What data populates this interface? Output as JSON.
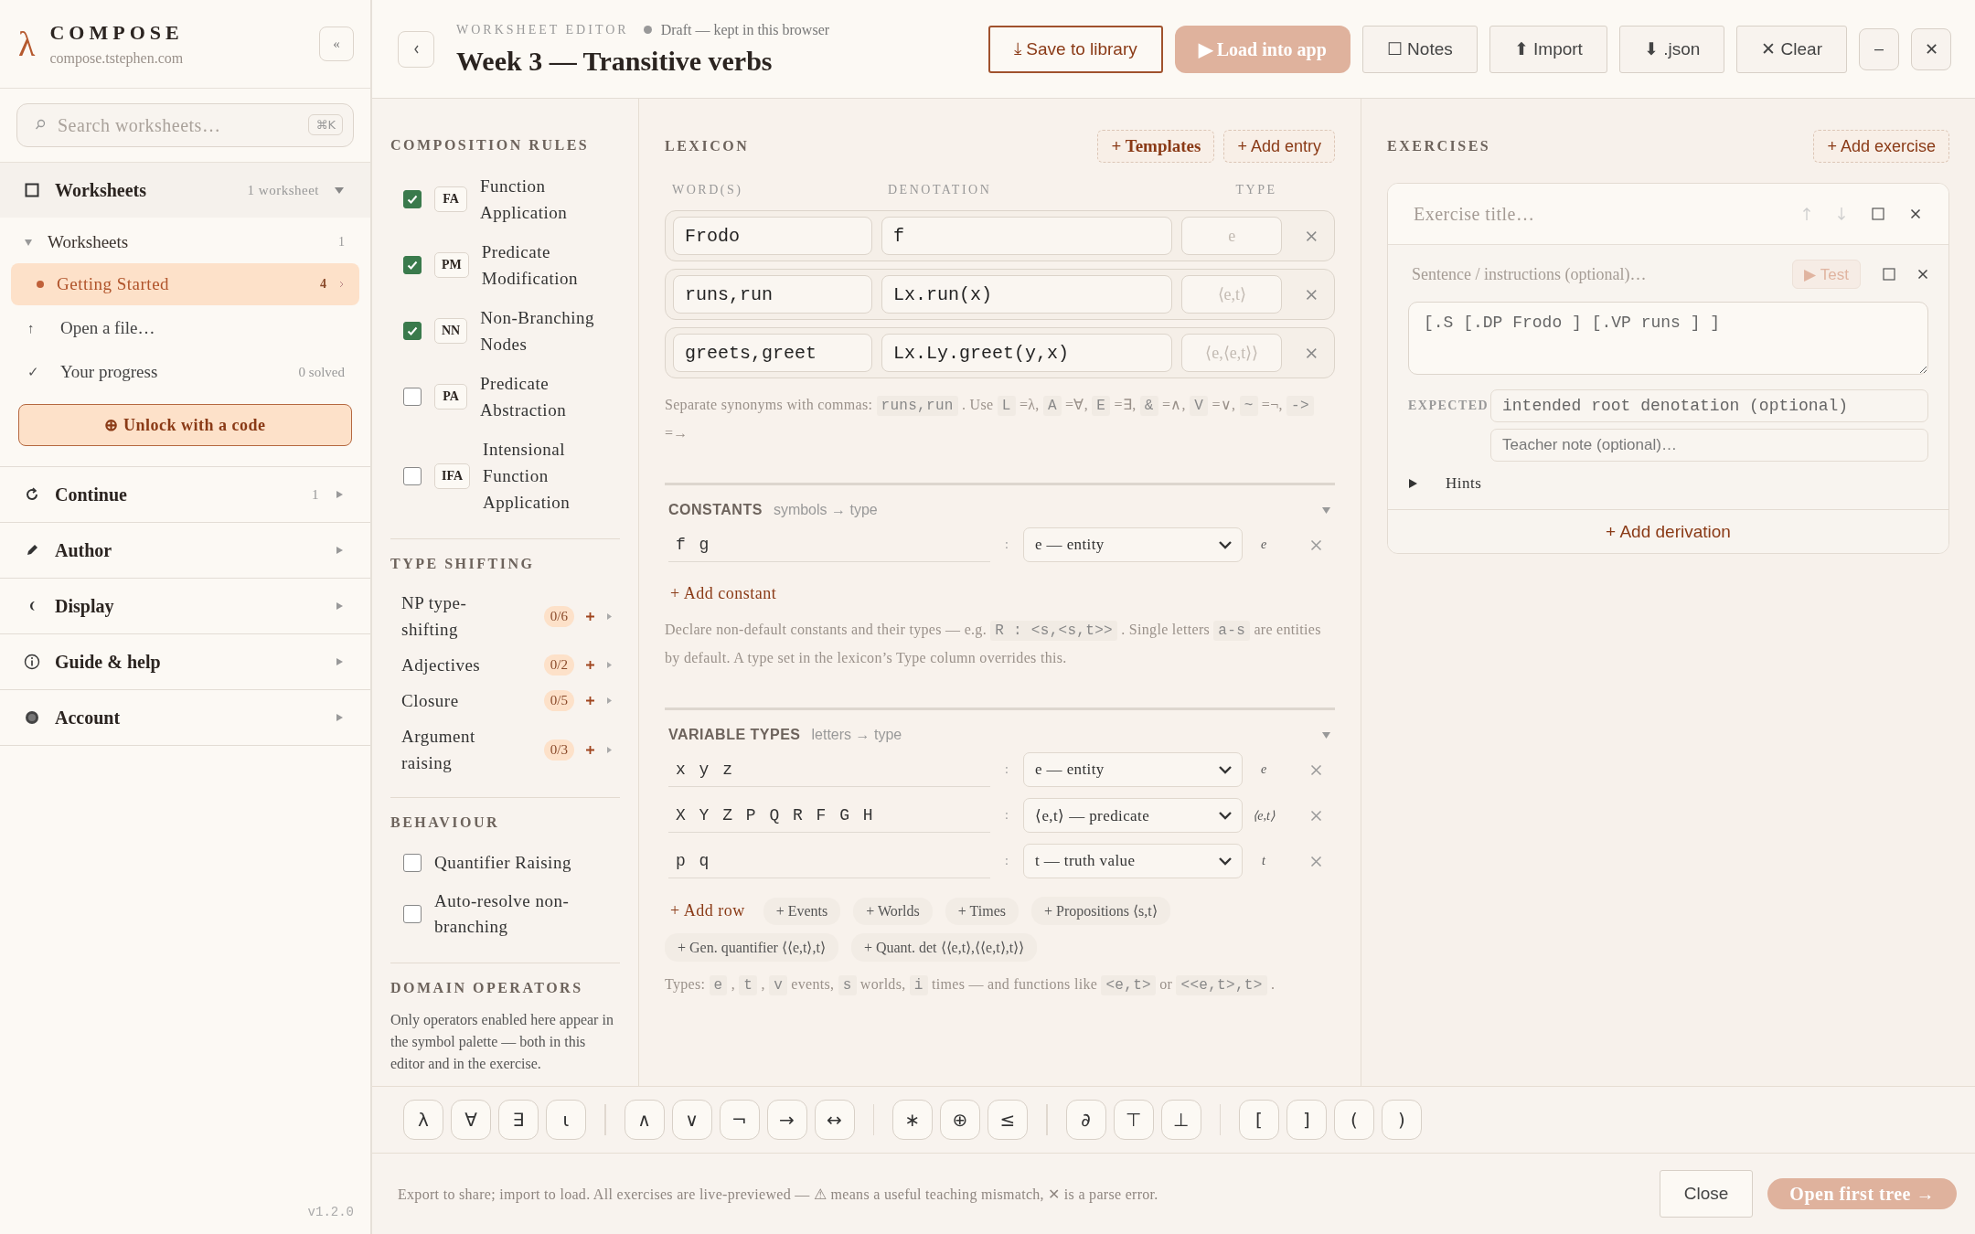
{
  "sidebar": {
    "brand": {
      "logo": "λ",
      "name": "COMPOSE",
      "url": "compose.tstephen.com"
    },
    "collapse": "«",
    "search": {
      "placeholder": "Search worksheets…",
      "shortcut": "⌘K"
    },
    "sections": [
      {
        "label": "Worksheets",
        "meta": "1 worksheet",
        "expanded": true,
        "panel": {
          "group": {
            "label": "Worksheets",
            "count": "1",
            "expanded": true
          },
          "items": [
            {
              "label": "Getting Started",
              "count": "4",
              "selected": true
            }
          ],
          "links": [
            {
              "icon": "↑",
              "label": "Open a file…"
            },
            {
              "icon": "✓",
              "label": "Your progress",
              "meta": "0 solved"
            }
          ],
          "unlock": "⊕ Unlock with a code"
        }
      },
      {
        "label": "Continue",
        "meta": "1",
        "expanded": false
      },
      {
        "label": "Author",
        "expanded": false
      },
      {
        "label": "Display",
        "expanded": false
      },
      {
        "label": "Guide & help",
        "expanded": false
      },
      {
        "label": "Account",
        "expanded": false
      }
    ],
    "version": "v1.2.0"
  },
  "header": {
    "eyebrow": "WORKSHEET EDITOR",
    "status": "Draft — kept in this browser",
    "title": "Week 3 — Transitive verbs",
    "buttons": [
      {
        "label": "⤓ Save to library",
        "kind": "outline"
      },
      {
        "label": "▶ Load into app",
        "kind": "primary"
      },
      {
        "label": "☐ Notes",
        "kind": "plain"
      },
      {
        "label": "⬆ Import",
        "kind": "plain"
      },
      {
        "label": "⬇ .json",
        "kind": "plain"
      },
      {
        "label": "✕ Clear",
        "kind": "plain"
      },
      {
        "label": "–",
        "kind": "square"
      },
      {
        "label": "✕",
        "kind": "square"
      }
    ]
  },
  "composition_rules": {
    "title": "COMPOSITION RULES",
    "rules": [
      {
        "abbr": "FA",
        "name": "Function Application",
        "checked": true
      },
      {
        "abbr": "PM",
        "name": "Predicate Modification",
        "checked": true
      },
      {
        "abbr": "NN",
        "name": "Non-Branching Nodes",
        "checked": true
      },
      {
        "abbr": "PA",
        "name": "Predicate Abstraction",
        "checked": false
      },
      {
        "abbr": "IFA",
        "name": "Intensional Function Application",
        "checked": false
      }
    ]
  },
  "type_shifting": {
    "title": "TYPE SHIFTING",
    "items": [
      {
        "name": "NP type-shifting",
        "count": "0/6"
      },
      {
        "name": "Adjectives",
        "count": "0/2"
      },
      {
        "name": "Closure",
        "count": "0/5"
      },
      {
        "name": "Argument raising",
        "count": "0/3"
      }
    ]
  },
  "behaviour": {
    "title": "BEHAVIOUR",
    "options": [
      {
        "label": "Quantifier Raising",
        "checked": false
      },
      {
        "label": "Auto-resolve non-branching",
        "checked": false
      }
    ]
  },
  "domain_operators": {
    "title": "DOMAIN OPERATORS",
    "text": "Only operators enabled here appear in the symbol palette — both in this editor and in the exercise."
  },
  "lexicon": {
    "title": "LEXICON",
    "templates": "+ Templates",
    "add": "+ Add entry",
    "columns": [
      "WORD(S)",
      "DENOTATION",
      "TYPE"
    ],
    "entries": [
      {
        "words": "Frodo",
        "denotation": "f",
        "type_placeholder": "e"
      },
      {
        "words": "runs,run",
        "denotation": "Lx.run(x)",
        "type_placeholder": "⟨e,t⟩"
      },
      {
        "words": "greets,greet",
        "denotation": "Lx.Ly.greet(y,x)",
        "type_placeholder": "⟨e,⟨e,t⟩⟩"
      }
    ],
    "help": [
      {
        "kind": "text",
        "text": "Separate synonyms with commas: "
      },
      {
        "kind": "code",
        "text": "runs,run"
      },
      {
        "kind": "text",
        "text": " . Use "
      },
      {
        "kind": "code",
        "text": "L"
      },
      {
        "kind": "text",
        "text": " =λ, "
      },
      {
        "kind": "code",
        "text": "A"
      },
      {
        "kind": "text",
        "text": " =∀, "
      },
      {
        "kind": "code",
        "text": "E"
      },
      {
        "kind": "text",
        "text": " =∃, "
      },
      {
        "kind": "code",
        "text": "&"
      },
      {
        "kind": "text",
        "text": " =∧, "
      },
      {
        "kind": "code",
        "text": "V"
      },
      {
        "kind": "text",
        "text": " =∨, "
      },
      {
        "kind": "code",
        "text": "~"
      },
      {
        "kind": "text",
        "text": " =¬, "
      },
      {
        "kind": "code",
        "text": "->"
      },
      {
        "kind": "text",
        "text": " =→"
      }
    ]
  },
  "constants": {
    "title": "CONSTANTS",
    "subtitle": "symbols → type",
    "expanded": true,
    "rows": [
      {
        "symbols": "f g",
        "separator": ":",
        "type": "e — entity",
        "short": "e"
      }
    ],
    "add": "+ Add constant",
    "help": [
      {
        "kind": "text",
        "text": "Declare non-default constants and their types — e.g. "
      },
      {
        "kind": "code",
        "text": "R : <s,<s,t>>"
      },
      {
        "kind": "text",
        "text": " . Single letters "
      },
      {
        "kind": "code",
        "text": "a-s"
      },
      {
        "kind": "text",
        "text": " are entities by default. A type set in the lexicon’s Type column overrides this."
      }
    ]
  },
  "variable_types": {
    "title": "VARIABLE TYPES",
    "subtitle": "letters → type",
    "expanded": true,
    "rows": [
      {
        "symbols": "x y z",
        "separator": ":",
        "type": "e — entity",
        "short": "e"
      },
      {
        "symbols": "X Y Z P Q R F G H",
        "separator": ":",
        "type": "⟨e,t⟩ — predicate",
        "short": "⟨e,t⟩"
      },
      {
        "symbols": "p q",
        "separator": ":",
        "type": "t — truth value",
        "short": "t"
      }
    ],
    "add": "+ Add row",
    "chips": [
      "+ Events",
      "+ Worlds",
      "+ Times",
      "+ Propositions ⟨s,t⟩",
      "+ Gen. quantifier ⟨⟨e,t⟩,t⟩",
      "+ Quant. det ⟨⟨e,t⟩,⟨⟨e,t⟩,t⟩⟩"
    ],
    "help": [
      {
        "kind": "text",
        "text": "Types: "
      },
      {
        "kind": "code",
        "text": "e"
      },
      {
        "kind": "text",
        "text": " , "
      },
      {
        "kind": "code",
        "text": "t"
      },
      {
        "kind": "text",
        "text": " , "
      },
      {
        "kind": "code",
        "text": "v"
      },
      {
        "kind": "text",
        "text": " events, "
      },
      {
        "kind": "code",
        "text": "s"
      },
      {
        "kind": "text",
        "text": " worlds, "
      },
      {
        "kind": "code",
        "text": "i"
      },
      {
        "kind": "text",
        "text": " times — and functions like "
      },
      {
        "kind": "code",
        "text": "<e,t>"
      },
      {
        "kind": "text",
        "text": " or "
      },
      {
        "kind": "code",
        "text": "<<e,t>,t>"
      },
      {
        "kind": "text",
        "text": " ."
      }
    ]
  },
  "exercises": {
    "title": "EXERCISES",
    "add": "+ Add exercise",
    "cards": [
      {
        "title_placeholder": "Exercise title…",
        "sentence_placeholder": "Sentence / instructions (optional)…",
        "test": "▶ Test",
        "tree": "[.S [.DP Frodo ] [.VP runs ] ]",
        "expected_label": "EXPECTED",
        "expected_placeholder": "intended root denotation (optional)",
        "note_placeholder": "Teacher note (optional)…",
        "hints": {
          "label": "Hints",
          "expanded": false
        },
        "add_derivation": "+ Add derivation"
      }
    ]
  },
  "palette": [
    [
      "λ",
      "∀",
      "∃",
      "ι"
    ],
    [
      "∧",
      "∨",
      "¬",
      "→",
      "↔"
    ],
    [
      "∗",
      "⊕",
      "≤"
    ],
    [
      "∂",
      "⊤",
      "⊥"
    ],
    [
      "[",
      "]",
      "(",
      ")"
    ]
  ],
  "footer": {
    "text": "Export to share; import to load. All exercises are live-previewed — ⚠ means a useful teaching mismatch, ✕ is a parse error.",
    "close": "Close",
    "primary": "Open first tree →"
  }
}
